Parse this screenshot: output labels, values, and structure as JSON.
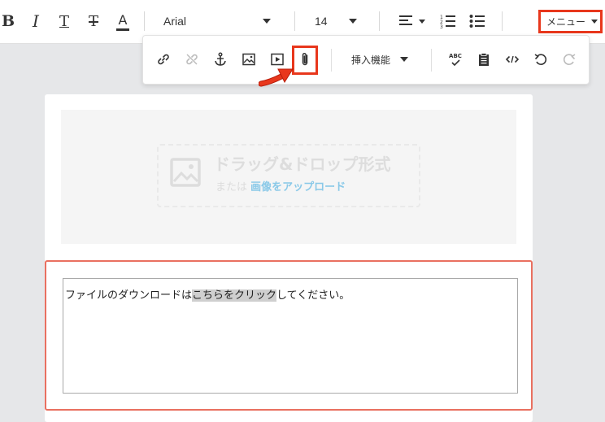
{
  "toolbar": {
    "bold_glyph": "B",
    "italic_glyph": "I",
    "underline_glyph": "T",
    "strike_glyph": "T",
    "color_glyph": "A",
    "font_family_value": "Arial",
    "font_size_value": "14",
    "menu_label": "メニュー"
  },
  "popup": {
    "insert_label": "挿入機能",
    "spellcheck_label": "ABC"
  },
  "dropzone": {
    "title": "ドラッグ&ドロップ形式",
    "or_text": "または",
    "upload_link": "画像をアップロード"
  },
  "content": {
    "text_before": "ファイルのダウンロードは",
    "link_text": "こちらをクリック",
    "text_after": "してください。"
  },
  "colors": {
    "highlight_red": "#e8371c",
    "block_border": "#e97060",
    "upload_link": "#8ac9e8"
  }
}
